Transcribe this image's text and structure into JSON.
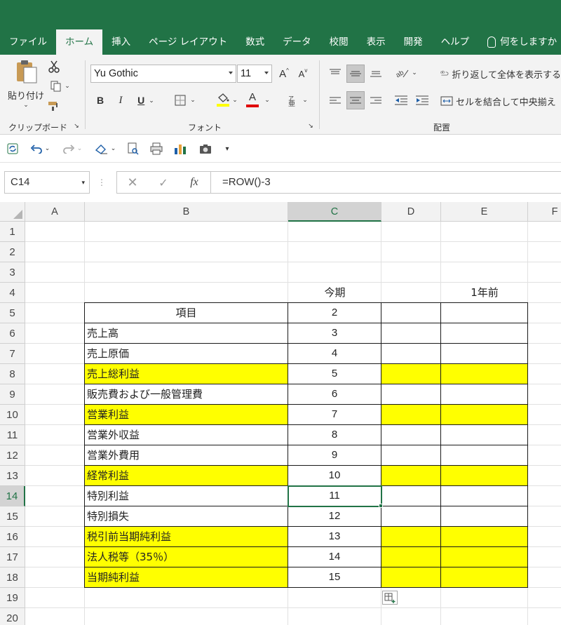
{
  "menu": {
    "tabs": [
      "ファイル",
      "ホーム",
      "挿入",
      "ページ レイアウト",
      "数式",
      "データ",
      "校閲",
      "表示",
      "開発",
      "ヘルプ"
    ],
    "active_index": 1,
    "tell_me": "何をしますか"
  },
  "ribbon": {
    "paste_label": "貼り付け",
    "clipboard_label": "クリップボード",
    "font_label": "フォント",
    "alignment_label": "配置",
    "font_name": "Yu Gothic",
    "font_size": "11",
    "bold": "B",
    "italic": "I",
    "underline": "U",
    "font_color_glyph": "A",
    "wrap_text": "折り返して全体を表示する",
    "merge_center": "セルを結合して中央揃え",
    "grow_font": "A",
    "shrink_font": "A"
  },
  "formula_bar": {
    "name_box": "C14",
    "formula": "=ROW()-3",
    "fx": "fx"
  },
  "columns": [
    "A",
    "B",
    "C",
    "D",
    "E",
    "F"
  ],
  "selected_column": "C",
  "rows": [
    "1",
    "2",
    "3",
    "4",
    "5",
    "6",
    "7",
    "8",
    "9",
    "10",
    "11",
    "12",
    "13",
    "14",
    "15",
    "16",
    "17",
    "18",
    "19",
    "20"
  ],
  "selected_row": "14",
  "sheet": {
    "c4": "今期",
    "e4": "1年前",
    "table": [
      {
        "item": "項目",
        "value": "2",
        "highlight": false,
        "header": true
      },
      {
        "item": "売上高",
        "value": "3",
        "highlight": false
      },
      {
        "item": "売上原価",
        "value": "4",
        "highlight": false
      },
      {
        "item": "売上総利益",
        "value": "5",
        "highlight": true
      },
      {
        "item": "販売費および一般管理費",
        "value": "6",
        "highlight": false
      },
      {
        "item": "営業利益",
        "value": "7",
        "highlight": true
      },
      {
        "item": "営業外収益",
        "value": "8",
        "highlight": false
      },
      {
        "item": "営業外費用",
        "value": "9",
        "highlight": false
      },
      {
        "item": "経常利益",
        "value": "10",
        "highlight": true
      },
      {
        "item": "特別利益",
        "value": "11",
        "highlight": false
      },
      {
        "item": "特別損失",
        "value": "12",
        "highlight": false
      },
      {
        "item": "税引前当期純利益",
        "value": "13",
        "highlight": true
      },
      {
        "item": "法人税等（35％）",
        "value": "14",
        "highlight": true
      },
      {
        "item": "当期純利益",
        "value": "15",
        "highlight": true
      }
    ]
  },
  "colors": {
    "excel_green": "#217346",
    "highlight": "#ffff00"
  }
}
